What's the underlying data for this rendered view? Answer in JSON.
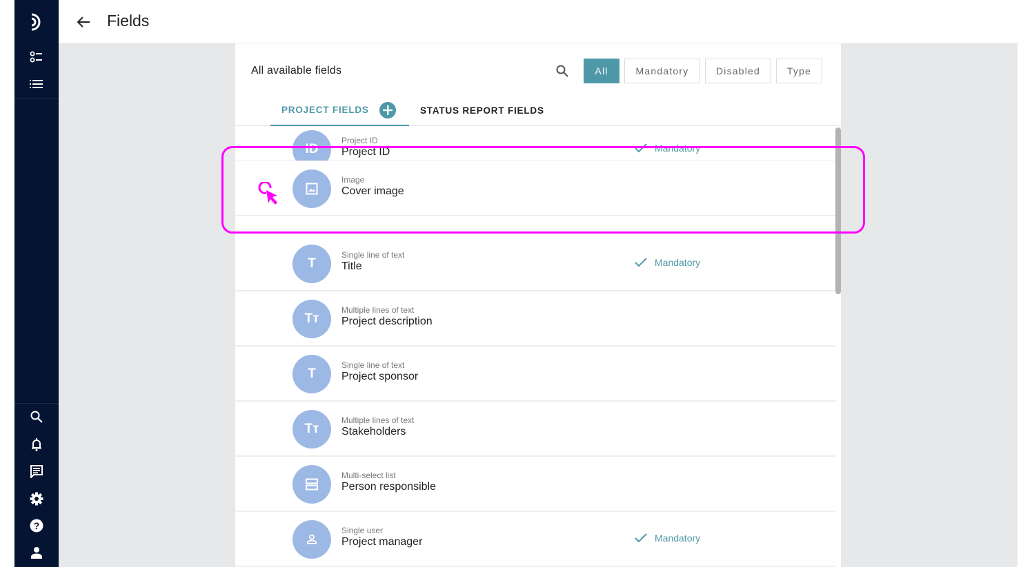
{
  "header": {
    "title": "Fields",
    "back_icon": "arrow-left-icon"
  },
  "sidebar": {
    "logo_icon": "brand-logo-icon",
    "top_items": [
      {
        "name": "checklist-icon"
      },
      {
        "name": "list-icon"
      }
    ],
    "bottom_items": [
      {
        "name": "search-icon"
      },
      {
        "name": "bell-icon"
      },
      {
        "name": "chat-icon"
      },
      {
        "name": "gear-icon"
      },
      {
        "name": "help-icon"
      },
      {
        "name": "user-icon"
      }
    ]
  },
  "panel": {
    "title": "All available fields",
    "filters": [
      {
        "label": "All",
        "active": true
      },
      {
        "label": "Mandatory",
        "active": false
      },
      {
        "label": "Disabled",
        "active": false
      },
      {
        "label": "Type",
        "active": false
      }
    ],
    "tabs": [
      {
        "label": "PROJECT FIELDS",
        "active": true
      },
      {
        "label": "STATUS REPORT FIELDS",
        "active": false
      }
    ]
  },
  "fields": [
    {
      "type": "Project ID",
      "name": "Project ID",
      "avatar_text": "ID",
      "mandatory": true
    },
    {
      "type": "Image",
      "name": "Cover image",
      "avatar_icon": "image-icon",
      "mandatory": false,
      "dragging": true
    },
    {
      "type": "Single line of text",
      "name": "Title",
      "avatar_text": "T",
      "mandatory": true
    },
    {
      "type": "Multiple lines of text",
      "name": "Project description",
      "avatar_text": "Tт",
      "mandatory": false
    },
    {
      "type": "Single line of text",
      "name": "Project sponsor",
      "avatar_text": "T",
      "mandatory": false
    },
    {
      "type": "Multiple lines of text",
      "name": "Stakeholders",
      "avatar_text": "Tт",
      "mandatory": false
    },
    {
      "type": "Multi-select list",
      "name": "Person responsible",
      "avatar_icon": "multi-select-icon",
      "mandatory": false
    },
    {
      "type": "Single user",
      "name": "Project manager",
      "avatar_icon": "person-icon",
      "mandatory": true
    }
  ],
  "mandatory_label": "Mandatory",
  "colors": {
    "accent": "#4e98a8",
    "sidebar": "#041432",
    "avatar": "#9cb8e4",
    "highlight": "#ff00ff",
    "background": "#e7e8ea"
  }
}
